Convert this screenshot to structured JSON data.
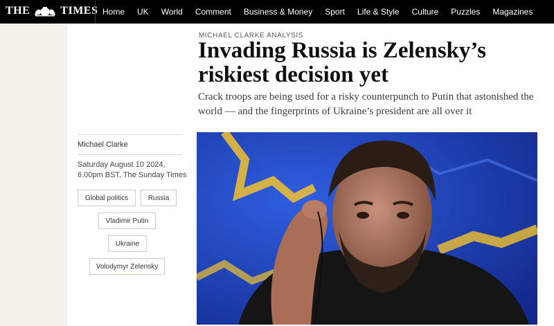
{
  "header": {
    "logo_text": "THE TIMES",
    "nav_items": [
      "Home",
      "UK",
      "World",
      "Comment",
      "Business & Money",
      "Sport",
      "Life & Style",
      "Culture",
      "Puzzles",
      "Magazines"
    ]
  },
  "article": {
    "kicker": "MICHAEL CLARKE ANALYSIS",
    "headline": "Invading Russia is Zelensky’s riskiest decision yet",
    "standfirst": "Crack troops are being used for a risky counterpunch to Putin that astonished the world — and the fingerprints of Ukraine’s president are all over it"
  },
  "meta": {
    "author": "Michael Clarke",
    "date_line1": "Saturday August 10 2024,",
    "date_line2": "6.00pm BST, The Sunday Times"
  },
  "tags": [
    "Global politics",
    "Russia",
    "Vladimir Putin",
    "Ukraine",
    "Volodymyr Zelensky"
  ],
  "colors": {
    "nav_background": "#000000",
    "page_strip": "#f4f0ea",
    "hero_background": "#1c3fb8",
    "hero_accent": "#f2c230"
  }
}
